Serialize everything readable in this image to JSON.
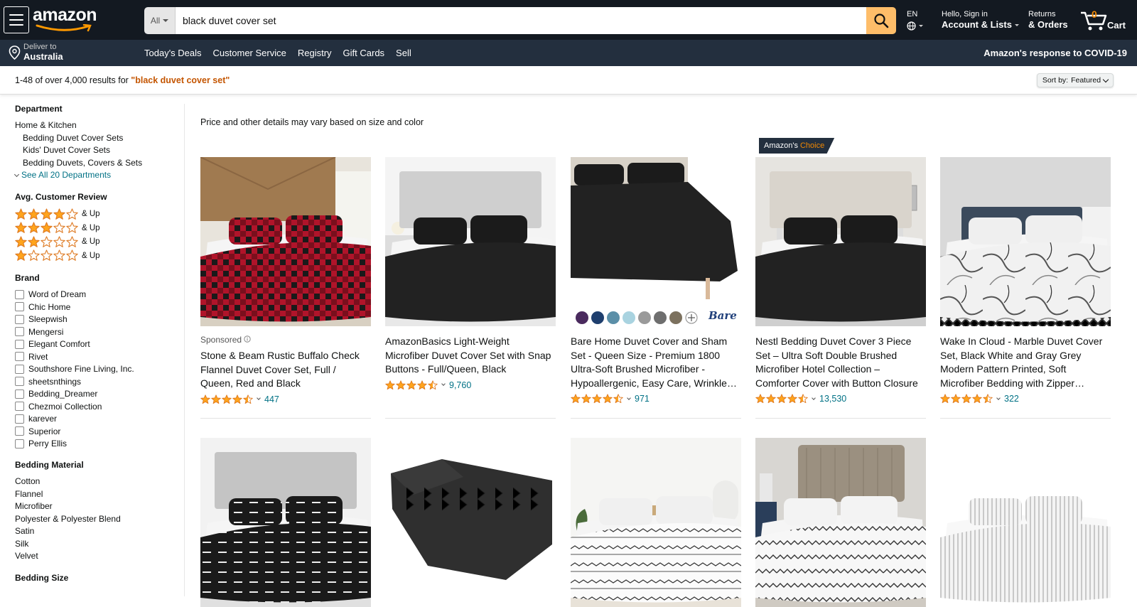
{
  "header": {
    "logo_text": "amazon",
    "search": {
      "category": "All",
      "value": "black duvet cover set"
    },
    "lang": "EN",
    "account": {
      "line1": "Hello, Sign in",
      "line2": "Account & Lists"
    },
    "orders": {
      "line1": "Returns",
      "line2": "& Orders"
    },
    "cart": {
      "count": "0",
      "label": "Cart"
    }
  },
  "subnav": {
    "deliver_line1": "Deliver to",
    "deliver_line2": "Australia",
    "links": [
      "Today's Deals",
      "Customer Service",
      "Registry",
      "Gift Cards",
      "Sell"
    ],
    "covid": "Amazon's response to COVID-19"
  },
  "results": {
    "prefix": "1-48 of over 4,000 results for ",
    "query": "\"black duvet cover set\"",
    "sort_label": "Sort by:",
    "sort_value": "Featured"
  },
  "sidebar": {
    "department": {
      "heading": "Department",
      "top": "Home & Kitchen",
      "subs": [
        "Bedding Duvet Cover Sets",
        "Kids' Duvet Cover Sets",
        "Bedding Duvets, Covers & Sets"
      ],
      "see_all": "See All 20 Departments"
    },
    "review": {
      "heading": "Avg. Customer Review",
      "rows": [
        {
          "stars": 4,
          "label": "& Up"
        },
        {
          "stars": 3,
          "label": "& Up"
        },
        {
          "stars": 2,
          "label": "& Up"
        },
        {
          "stars": 1,
          "label": "& Up"
        }
      ]
    },
    "brand": {
      "heading": "Brand",
      "items": [
        "Word of Dream",
        "Chic Home",
        "Sleepwish",
        "Mengersi",
        "Elegant Comfort",
        "Rivet",
        "Southshore Fine Living, Inc.",
        "sheetsnthings",
        "Bedding_Dreamer",
        "Chezmoi Collection",
        "karever",
        "Superior",
        "Perry Ellis"
      ]
    },
    "material": {
      "heading": "Bedding Material",
      "items": [
        "Cotton",
        "Flannel",
        "Microfiber",
        "Polyester & Polyester Blend",
        "Satin",
        "Silk",
        "Velvet"
      ]
    },
    "size": {
      "heading": "Bedding Size"
    }
  },
  "main": {
    "price_note": "Price and other details may vary based on size and color",
    "amazons_choice": {
      "part1": "Amazon's",
      "part2": "Choice"
    },
    "products": [
      {
        "sponsored": "Sponsored",
        "title": "Stone & Beam Rustic Buffalo Check Flannel Duvet Cover Set, Full / Queen, Red and Black",
        "rating": 4.5,
        "reviews": "447",
        "image": "red-plaid-bed"
      },
      {
        "title": "AmazonBasics Light-Weight Microfiber Duvet Cover Set with Snap Buttons - Full/Queen, Black",
        "rating": 4.5,
        "reviews": "9,760",
        "image": "black-bed"
      },
      {
        "title": "Bare Home Duvet Cover and Sham Set - Queen Size - Premium 1800 Ultra-Soft Brushed Microfiber - Hypoallergenic, Easy Care, Wrinkle Resistant",
        "rating": 4.5,
        "reviews": "971",
        "image": "black-bed-bare",
        "brand_logo": "Bare"
      },
      {
        "title": "Nestl Bedding Duvet Cover 3 Piece Set – Ultra Soft Double Brushed Microfiber Hotel Collection – Comforter Cover with Button Closure",
        "rating": 4.5,
        "reviews": "13,530",
        "image": "black-bed-room"
      },
      {
        "title": "Wake In Cloud - Marble Duvet Cover Set, Black White and Gray Grey Modern Pattern Printed, Soft Microfiber Bedding with Zipper Closure",
        "rating": 4.5,
        "reviews": "322",
        "image": "marble-bed"
      },
      {
        "image": "black-pattern-bed"
      },
      {
        "image": "black-pintuck-comforter"
      },
      {
        "image": "white-geometric-bed"
      },
      {
        "image": "white-aztec-bed"
      },
      {
        "image": "white-stripe-bed"
      }
    ],
    "swatch_colors": [
      "#4a2a5e",
      "#1f3f6e",
      "#5b8fa8",
      "#a9d3e0",
      "#9a9a9a",
      "#6e6e6e",
      "#7c715e"
    ]
  },
  "colors": {
    "nav_dark": "#131921",
    "nav_sub": "#232f3e",
    "search_button": "#febd69",
    "link": "#007185",
    "query": "#c45500",
    "star": "#ffa41c"
  }
}
